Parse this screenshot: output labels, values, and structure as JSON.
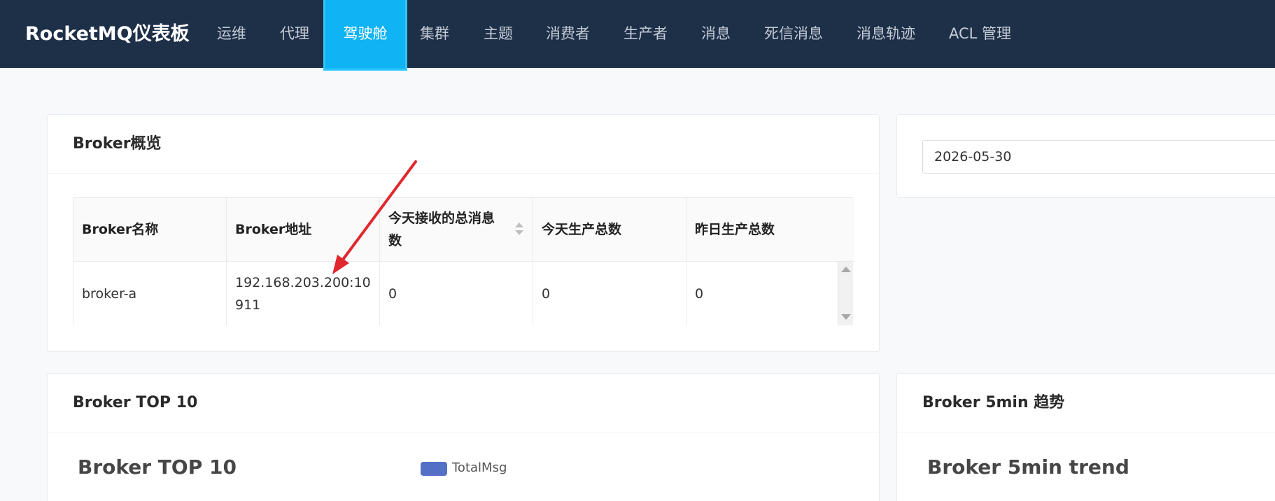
{
  "app": {
    "brand": "RocketMQ仪表板"
  },
  "nav": {
    "items": [
      {
        "label": "运维"
      },
      {
        "label": "代理"
      },
      {
        "label": "驾驶舱"
      },
      {
        "label": "集群"
      },
      {
        "label": "主题"
      },
      {
        "label": "消费者"
      },
      {
        "label": "生产者"
      },
      {
        "label": "消息"
      },
      {
        "label": "死信消息"
      },
      {
        "label": "消息轨迹"
      },
      {
        "label": "ACL 管理"
      }
    ],
    "active": "驾驶舱"
  },
  "overview": {
    "title": "Broker概览",
    "columns": [
      {
        "label": "Broker名称"
      },
      {
        "label": "Broker地址"
      },
      {
        "label": "今天接收的总消息数"
      },
      {
        "label": "今天生产总数"
      },
      {
        "label": "昨日生产总数"
      }
    ],
    "rows": [
      {
        "name": "broker-a",
        "address": "192.168.203.200:10911",
        "today_received": "0",
        "today_produced": "0",
        "yesterday_produced": "0"
      }
    ]
  },
  "date_picker": {
    "value": "2026-05-30"
  },
  "top10": {
    "card_title": "Broker TOP 10",
    "chart_title": "Broker TOP 10",
    "legend": {
      "label": "TotalMsg",
      "color": "#5470c6"
    }
  },
  "trend": {
    "card_title": "Broker 5min 趋势",
    "chart_title": "Broker 5min trend"
  },
  "colors": {
    "navbar": "#1e2f48",
    "active_tab": "#10b3f3",
    "annotation_arrow": "#e0282e"
  }
}
